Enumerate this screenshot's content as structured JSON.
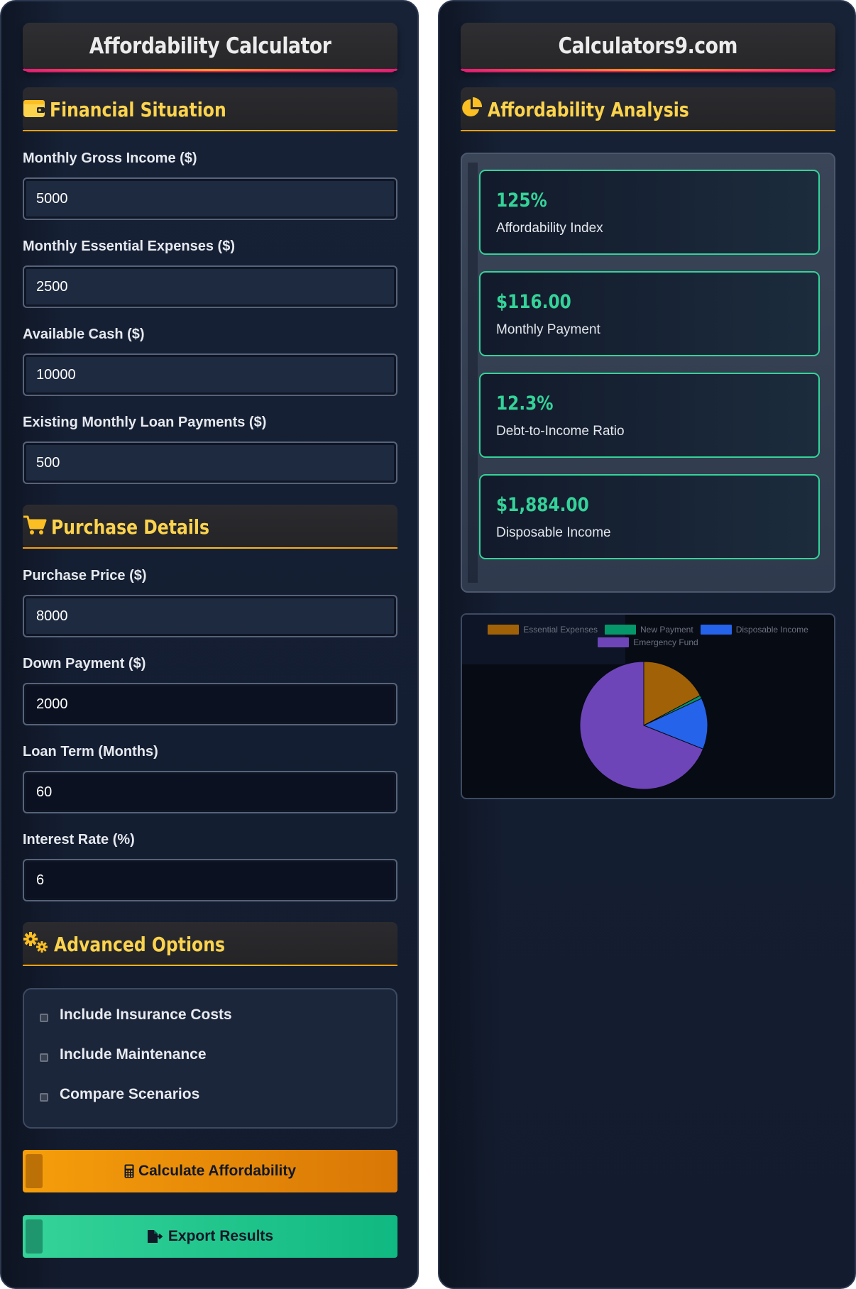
{
  "left": {
    "title": "Affordability Calculator",
    "sections": {
      "financial": "Financial Situation",
      "purchase": "Purchase Details",
      "advanced": "Advanced Options"
    },
    "fields": [
      {
        "label": "Monthly Gross Income ($)",
        "value": "5000"
      },
      {
        "label": "Monthly Essential Expenses ($)",
        "value": "2500"
      },
      {
        "label": "Available Cash ($)",
        "value": "10000"
      },
      {
        "label": "Existing Monthly Loan Payments ($)",
        "value": "500"
      },
      {
        "label": "Purchase Price ($)",
        "value": "8000"
      },
      {
        "label": "Down Payment ($)",
        "value": "2000"
      },
      {
        "label": "Loan Term (Months)",
        "value": "60"
      },
      {
        "label": "Interest Rate (%)",
        "value": "6"
      }
    ],
    "options": [
      {
        "label": "Include Insurance Costs",
        "checked": false
      },
      {
        "label": "Include Maintenance",
        "checked": false
      },
      {
        "label": "Compare Scenarios",
        "checked": false
      }
    ],
    "buttons": {
      "calculate": "Calculate Affordability",
      "export": "Export Results"
    }
  },
  "right": {
    "title": "Calculators9.com",
    "section": "Affordability Analysis",
    "metrics": [
      {
        "value": "125%",
        "label": "Affordability Index"
      },
      {
        "value": "$116.00",
        "label": "Monthly Payment"
      },
      {
        "value": "12.3%",
        "label": "Debt-to-Income Ratio"
      },
      {
        "value": "$1,884.00",
        "label": "Disposable Income"
      }
    ]
  },
  "colors": {
    "accent_gold": "#fcd34d",
    "accent_green": "#34d399",
    "accent_orange": "#f59e0b",
    "panel_bg": "#172236"
  },
  "chart_data": {
    "type": "pie",
    "categories": [
      "Essential Expenses",
      "New Payment",
      "Disposable Income",
      "Emergency Fund"
    ],
    "values": [
      2500,
      116,
      1884,
      10000
    ],
    "colors": [
      "#a16207",
      "#059669",
      "#2563eb",
      "#6d45b8"
    ],
    "legend": "top"
  }
}
